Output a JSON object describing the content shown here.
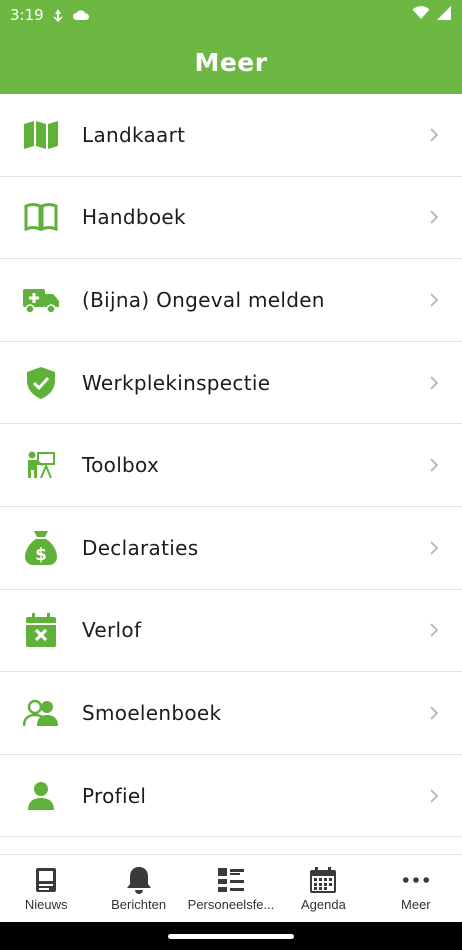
{
  "status_bar": {
    "time": "3:19"
  },
  "header": {
    "title": "Meer"
  },
  "colors": {
    "accent": "#6db843",
    "icon_green": "#5fb13a",
    "nav_icon": "#3a3a3a"
  },
  "menu": {
    "items": [
      {
        "label": "Landkaart",
        "icon": "map-icon"
      },
      {
        "label": "Handboek",
        "icon": "book-icon"
      },
      {
        "label": "(Bijna) Ongeval melden",
        "icon": "ambulance-icon"
      },
      {
        "label": "Werkplekinspectie",
        "icon": "shield-check-icon"
      },
      {
        "label": "Toolbox",
        "icon": "presentation-icon"
      },
      {
        "label": "Declaraties",
        "icon": "money-bag-icon"
      },
      {
        "label": "Verlof",
        "icon": "calendar-x-icon"
      },
      {
        "label": "Smoelenboek",
        "icon": "users-icon"
      },
      {
        "label": "Profiel",
        "icon": "user-icon"
      }
    ]
  },
  "bottom_nav": {
    "items": [
      {
        "label": "Nieuws",
        "icon": "newspaper-icon"
      },
      {
        "label": "Berichten",
        "icon": "bell-icon"
      },
      {
        "label": "Personeelsfe...",
        "icon": "list-icon"
      },
      {
        "label": "Agenda",
        "icon": "calendar-icon"
      },
      {
        "label": "Meer",
        "icon": "more-icon"
      }
    ]
  }
}
